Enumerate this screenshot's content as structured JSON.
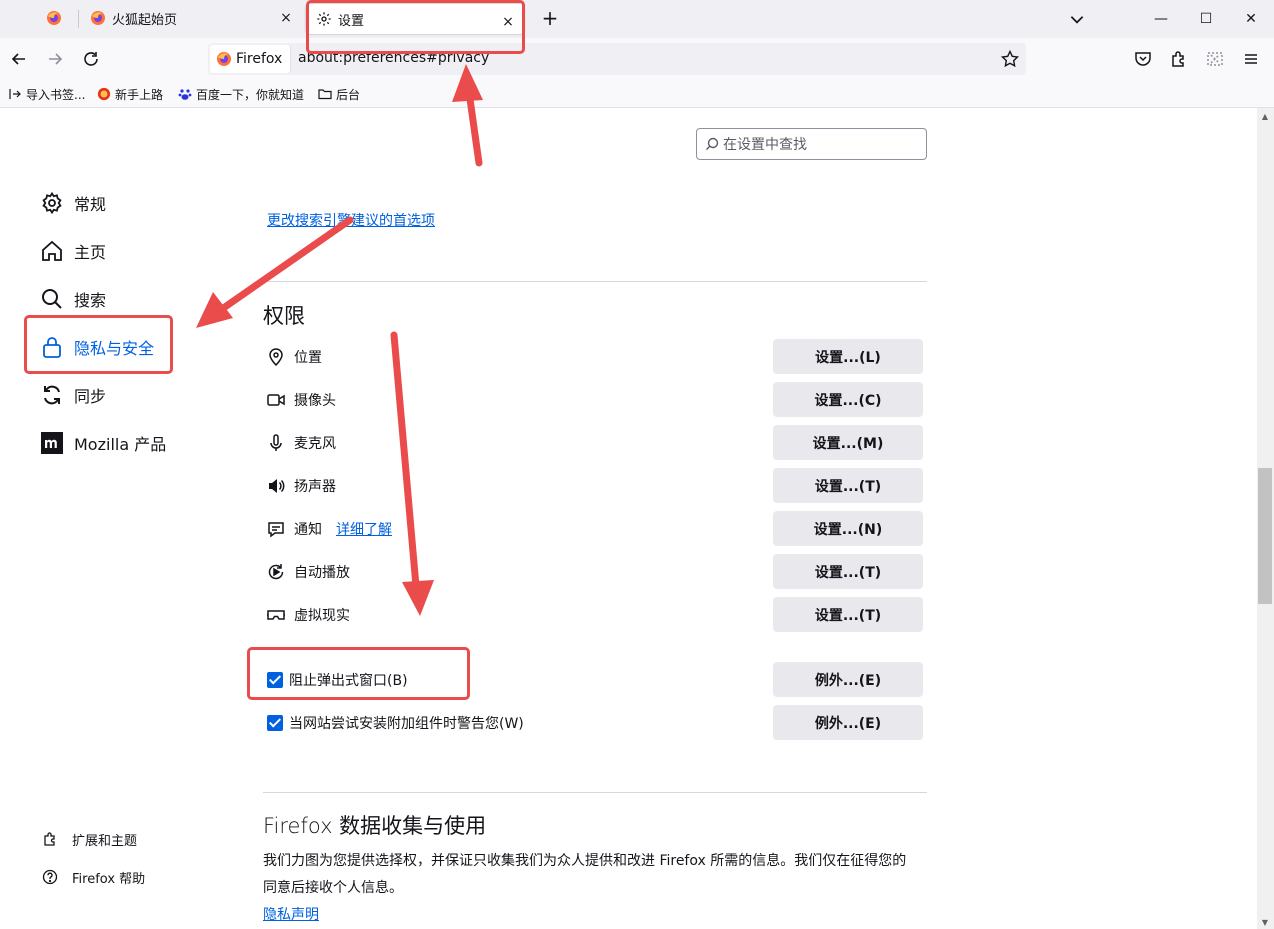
{
  "tabs": {
    "home_title": "火狐起始页",
    "settings_title": "设置",
    "close_glyph": "×",
    "newtab_glyph": "+"
  },
  "window_controls": {
    "minimize": "—",
    "maximize": "☐",
    "close": "✕"
  },
  "navbar": {
    "identity_label": "Firefox",
    "url": "about:preferences#privacy"
  },
  "bookmarks": [
    {
      "label": "导入书签...",
      "icon": "import-icon"
    },
    {
      "label": "新手上路",
      "icon": "firefox-icon"
    },
    {
      "label": "百度一下，你就知道",
      "icon": "baidu-icon"
    },
    {
      "label": "后台",
      "icon": "folder-icon"
    }
  ],
  "search": {
    "placeholder": "在设置中查找"
  },
  "sidebar": {
    "items": [
      {
        "label": "常规",
        "icon": "gear-icon"
      },
      {
        "label": "主页",
        "icon": "home-icon"
      },
      {
        "label": "搜索",
        "icon": "search-icon"
      },
      {
        "label": "隐私与安全",
        "icon": "lock-icon",
        "selected": true
      },
      {
        "label": "同步",
        "icon": "sync-icon"
      },
      {
        "label": "Mozilla 产品",
        "icon": "mozilla-icon"
      }
    ],
    "footer": [
      {
        "label": "扩展和主题",
        "icon": "puzzle-icon"
      },
      {
        "label": "Firefox 帮助",
        "icon": "help-icon"
      }
    ]
  },
  "main": {
    "change_search_link": "更改搜索引擎建议的首选项",
    "permissions_heading": "权限",
    "permissions": [
      {
        "label": "位置",
        "icon": "location-icon",
        "button": "设置...(L)"
      },
      {
        "label": "摄像头",
        "icon": "camera-icon",
        "button": "设置...(C)"
      },
      {
        "label": "麦克风",
        "icon": "microphone-icon",
        "button": "设置...(M)"
      },
      {
        "label": "扬声器",
        "icon": "speaker-icon",
        "button": "设置...(T)"
      },
      {
        "label": "通知",
        "icon": "notification-icon",
        "button": "设置...(N)",
        "link": "详细了解"
      },
      {
        "label": "自动播放",
        "icon": "autoplay-icon",
        "button": "设置...(T)"
      },
      {
        "label": "虚拟现实",
        "icon": "vr-icon",
        "button": "设置...(T)"
      }
    ],
    "checks": [
      {
        "label": "阻止弹出式窗口(B)",
        "checked": true,
        "button": "例外...(E)"
      },
      {
        "label": "当网站尝试安装附加组件时警告您(W)",
        "checked": true,
        "button": "例外...(E)"
      }
    ],
    "data_heading": "Firefox 数据收集与使用",
    "data_description": "我们力图为您提供选择权，并保证只收集我们为众人提供和改进 Firefox 所需的信息。我们仅在征得您的同意后接收个人信息。",
    "privacy_link": "隐私声明"
  },
  "colors": {
    "accent": "#0061e0",
    "annotation": "#ea4b4b"
  }
}
